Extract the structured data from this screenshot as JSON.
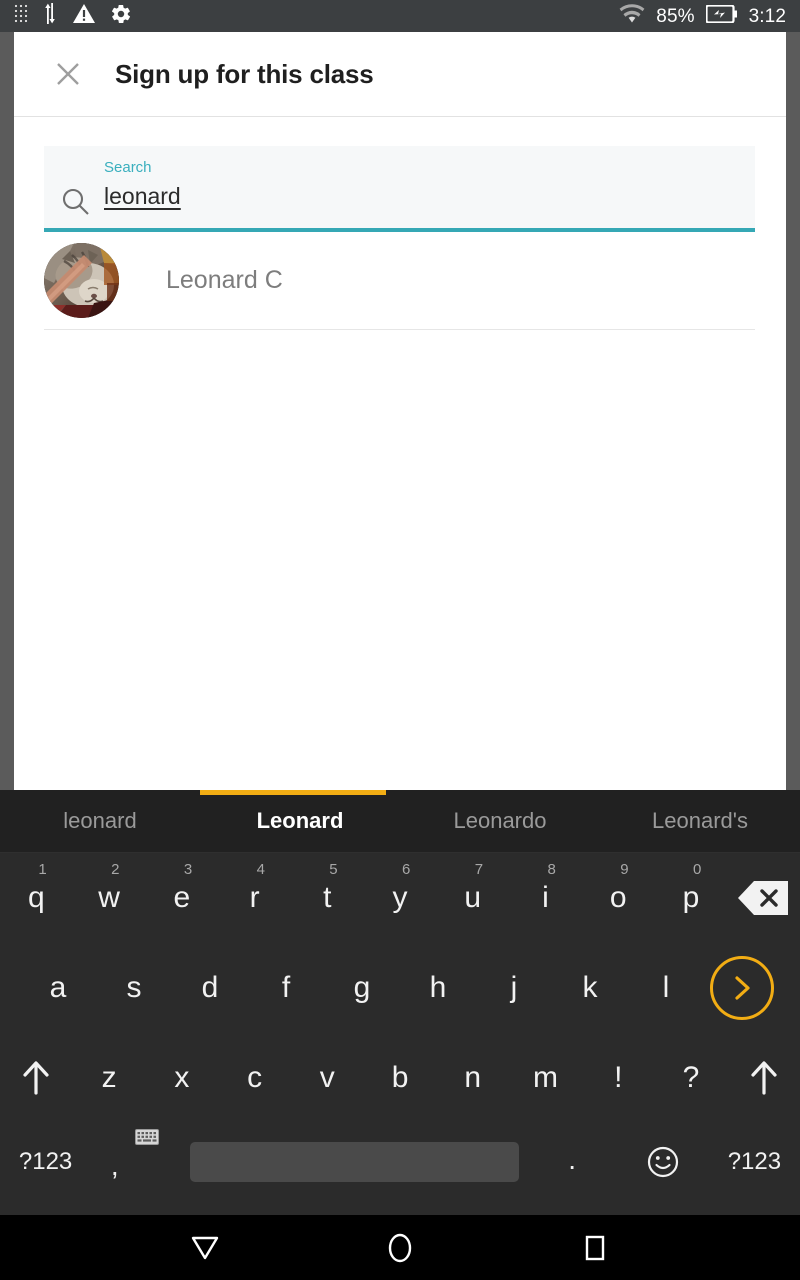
{
  "status_bar": {
    "icons_left": [
      "grid-dots-icon",
      "sync-arrows-icon",
      "warning-triangle-icon",
      "gear-icon"
    ],
    "wifi_icon": "wifi-icon",
    "battery_percent": "85%",
    "battery_icon": "battery-charging-icon",
    "clock": "3:12"
  },
  "dialog": {
    "close_icon": "close-icon",
    "title": "Sign up for this class",
    "search": {
      "icon": "search-icon",
      "label": "Search",
      "value": "leonard",
      "placeholder": "Search"
    },
    "results": [
      {
        "avatar": "cat-photo-avatar",
        "name": "Leonard C"
      }
    ]
  },
  "keyboard": {
    "suggestions": [
      {
        "text": "leonard",
        "selected": false
      },
      {
        "text": "Leonard",
        "selected": true
      },
      {
        "text": "Leonardo",
        "selected": false
      },
      {
        "text": "Leonard's",
        "selected": false
      }
    ],
    "accent_color": "#f2ad14",
    "row1": [
      {
        "key": "q",
        "num": "1"
      },
      {
        "key": "w",
        "num": "2"
      },
      {
        "key": "e",
        "num": "3"
      },
      {
        "key": "r",
        "num": "4"
      },
      {
        "key": "t",
        "num": "5"
      },
      {
        "key": "y",
        "num": "6"
      },
      {
        "key": "u",
        "num": "7"
      },
      {
        "key": "i",
        "num": "8"
      },
      {
        "key": "o",
        "num": "9"
      },
      {
        "key": "p",
        "num": "0"
      }
    ],
    "backspace_icon": "backspace-icon",
    "row2": [
      "a",
      "s",
      "d",
      "f",
      "g",
      "h",
      "j",
      "k",
      "l"
    ],
    "enter_icon": "chevron-right-icon",
    "row3": {
      "shift_left_icon": "shift-up-arrow-icon",
      "keys": [
        "z",
        "x",
        "c",
        "v",
        "b",
        "n",
        "m",
        "!",
        "?"
      ],
      "shift_right_icon": "shift-up-arrow-icon"
    },
    "row4": {
      "symbols_left": "?123",
      "comma": ",",
      "keyboard_switch_icon": "keyboard-icon",
      "space": "",
      "period": ".",
      "emoji_icon": "smiley-icon",
      "symbols_right": "?123"
    }
  },
  "nav_bar": {
    "back_icon": "back-triangle-icon",
    "home_icon": "home-circle-icon",
    "recents_icon": "recents-square-icon"
  },
  "colors": {
    "teal_accent": "#35a8b5",
    "label_teal": "#3aafbe",
    "keyboard_orange": "#f2ad14",
    "status_bar_bg": "#3c3f41",
    "keyboard_bg": "#2b2b2b"
  }
}
